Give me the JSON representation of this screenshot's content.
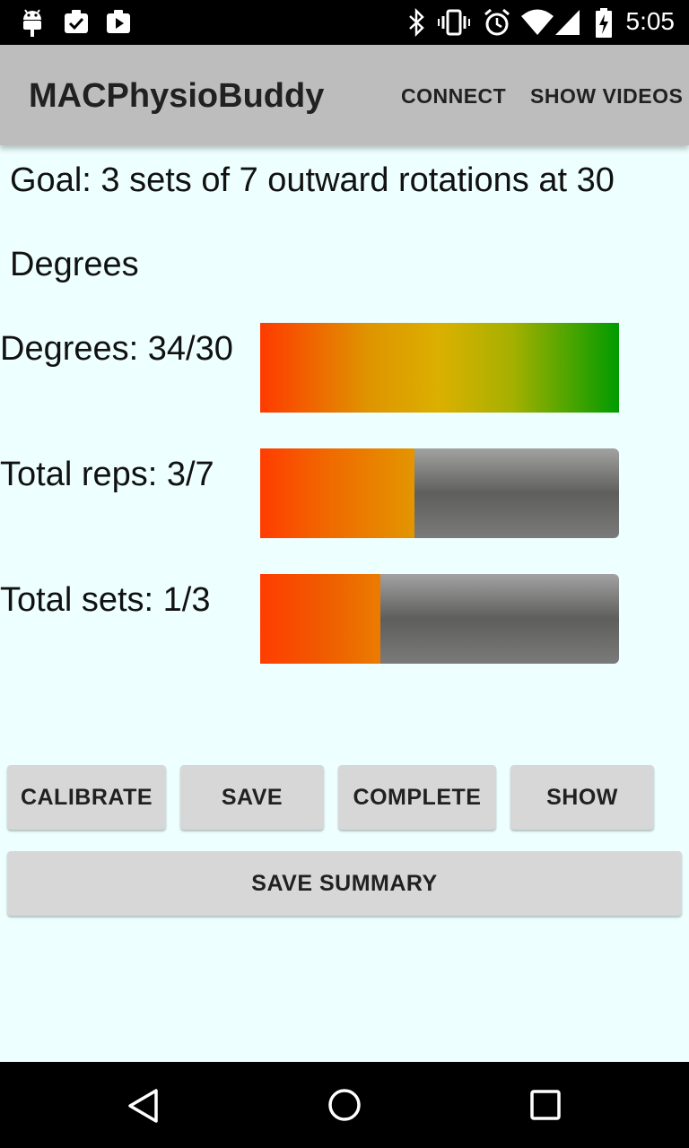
{
  "status_bar": {
    "time": "5:05",
    "left_icons": [
      "android-icon",
      "clipboard-check-icon",
      "play-store-icon"
    ],
    "right_icons": [
      "bluetooth-icon",
      "vibrate-icon",
      "alarm-icon",
      "wifi-icon",
      "cell-signal-icon",
      "battery-icon"
    ]
  },
  "app_bar": {
    "title": "MACPhysioBuddy",
    "actions": [
      "CONNECT",
      "SHOW VIDEOS"
    ]
  },
  "goal": {
    "line1": "Goal: 3 sets of 7 outward rotations at 30",
    "line2": "Degrees"
  },
  "metrics": {
    "degrees": {
      "label": "Degrees: 34/30",
      "value": 34,
      "target": 30,
      "progress": 1.0
    },
    "reps": {
      "label": "Total reps: 3/7",
      "value": 3,
      "target": 7,
      "progress": 0.43
    },
    "sets": {
      "label": "Total sets: 1/3",
      "value": 1,
      "target": 3,
      "progress": 0.335
    }
  },
  "buttons": {
    "calibrate": "CALIBRATE",
    "save": "SAVE",
    "complete": "COMPLETE",
    "show": "SHOW",
    "save_summary": "SAVE SUMMARY"
  },
  "nav_bar": {
    "icons": [
      "back-icon",
      "home-icon",
      "recents-icon"
    ]
  },
  "colors": {
    "background": "#edffff",
    "app_bar": "#bdbdbd",
    "bar_start": "#ff3a00",
    "bar_mid": "#dbb000",
    "bar_end": "#009b00",
    "bar_track": "#5e5f5c",
    "button": "#d7d7d7"
  }
}
